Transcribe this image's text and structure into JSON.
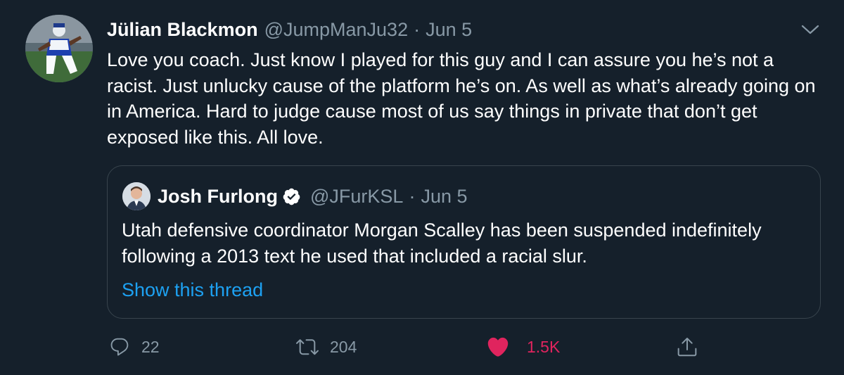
{
  "tweet": {
    "display_name": "Jülian Blackmon",
    "handle": "@JumpManJu32",
    "separator": "·",
    "date": "Jun 5",
    "text": "Love you coach. Just know I played for this guy and I can assure you he’s not a racist. Just unlucky cause of the platform he’s on. As well as what’s already going on in America. Hard to judge cause most of us say things in private that don’t get exposed like this. All love."
  },
  "quoted_tweet": {
    "display_name": "Josh Furlong",
    "verified": true,
    "handle": "@JFurKSL",
    "separator": "·",
    "date": "Jun 5",
    "text": "Utah defensive coordinator Morgan Scalley has been suspended indefinitely following a  2013 text he used that included a racial slur.",
    "show_thread_label": "Show this thread"
  },
  "actions": {
    "reply_count": "22",
    "retweet_count": "204",
    "like_count": "1.5K",
    "liked": true
  },
  "icons": {
    "menu": "chevron-down-icon",
    "reply": "reply-icon",
    "retweet": "retweet-icon",
    "like": "heart-icon",
    "share": "share-icon",
    "verified": "verified-badge-icon"
  },
  "colors": {
    "background": "#15202b",
    "secondary_text": "#8899a6",
    "link": "#1da1f2",
    "like": "#e0245e",
    "border": "#38444d"
  }
}
